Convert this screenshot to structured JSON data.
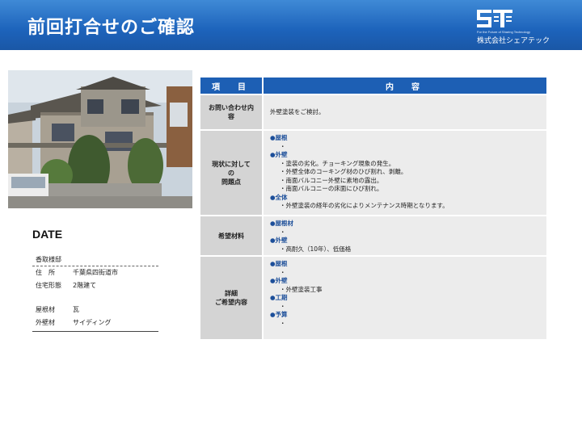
{
  "header": {
    "title": "前回打合せのご確認",
    "logo": {
      "mark": "ST",
      "tagline": "For the Future of Sharing Technology",
      "company": "株式会社シェアテック"
    }
  },
  "colors": {
    "header_blue": "#1d63bb",
    "table_header": "#1d5fb4",
    "row_header_bg": "#d4d4d4",
    "row_body_bg": "#ececec",
    "category_text": "#1d4f9a"
  },
  "photo": {
    "subject": "two-story house exterior photo"
  },
  "date_label": "DATE",
  "info": {
    "name": "香取様邸",
    "address_label": "住　所",
    "address_value": "千葉県四街道市",
    "type_label": "住宅形態",
    "type_value": "2階建て",
    "roof_label": "屋根材",
    "roof_value": "瓦",
    "wall_label": "外壁材",
    "wall_value": "サイディング"
  },
  "table": {
    "col1": "項　目",
    "col2": "内　容",
    "r1": {
      "head": "お問い合わせ内容",
      "body": "外壁塗装をご検討。"
    },
    "r2": {
      "head_l1": "現状に対して",
      "head_l2": "の",
      "head_l3": "問題点",
      "roof_cat": "●屋根",
      "roof_item": "・",
      "wall_cat": "●外壁",
      "wall_items": [
        "・塗装の劣化。チョーキング現象の発生。",
        "・外壁全体のコーキング材のひび割れ、剥離。",
        "・南面バルコニー外壁に素地の露出。",
        "・南面バルコニーの床面にひび割れ。"
      ],
      "all_cat": "●全体",
      "all_item": "・外壁塗装の経年の劣化によりメンテナンス時期となります。"
    },
    "r3": {
      "head": "希望材料",
      "roof_cat": "●屋根材",
      "roof_item": "・",
      "wall_cat": "●外壁",
      "wall_item": "・高耐久（10年）、低価格"
    },
    "r4": {
      "head_l1": "詳細",
      "head_l2": "ご希望内容",
      "roof_cat": "●屋根",
      "roof_item": "・",
      "wall_cat": "●外壁",
      "wall_item": "・外壁塗装工事",
      "period_cat": "●工期",
      "period_item": "・",
      "budget_cat": "●予算",
      "budget_item": "・"
    }
  }
}
